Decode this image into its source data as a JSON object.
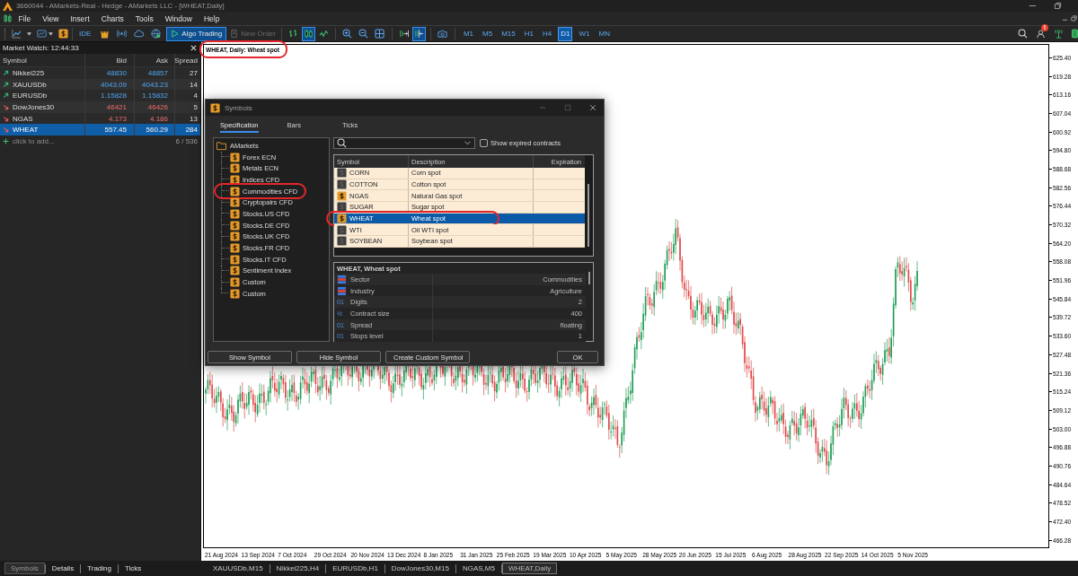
{
  "window": {
    "title": "3660044 - AMarkets-Real - Hedge - AMarkets LLC - [WHEAT,Daily]"
  },
  "menu": [
    "File",
    "View",
    "Insert",
    "Charts",
    "Tools",
    "Window",
    "Help"
  ],
  "toolbar": {
    "ide": "IDE",
    "algo_trading": {
      "label": "Algo Trading",
      "selected": true
    },
    "new_order": {
      "label": "New Order",
      "disabled": true
    },
    "chart_types": [
      {
        "selected": false
      },
      {
        "selected": true
      },
      {
        "selected": false
      }
    ],
    "chart_views": [
      {
        "selected": false
      },
      {
        "selected": true
      }
    ],
    "timeframes": [
      {
        "label": "M1",
        "selected": false
      },
      {
        "label": "M5",
        "selected": false
      },
      {
        "label": "M15",
        "selected": false
      },
      {
        "label": "H1",
        "selected": false
      },
      {
        "label": "H4",
        "selected": false
      },
      {
        "label": "D1",
        "selected": true
      },
      {
        "label": "W1",
        "selected": false
      },
      {
        "label": "MN",
        "selected": false
      }
    ],
    "alert_badge": "!"
  },
  "market_watch": {
    "title": "Market Watch: 12:44:33",
    "columns": [
      "Symbol",
      "Bid",
      "Ask",
      "Spread"
    ],
    "rows": [
      {
        "symbol": "Nikkei225",
        "bid": "48830",
        "ask": "48857",
        "spread": "27",
        "rising": true,
        "selected": false
      },
      {
        "symbol": "XAUUSDb",
        "bid": "4043.09",
        "ask": "4043.23",
        "spread": "14",
        "rising": true,
        "selected": false
      },
      {
        "symbol": "EURUSDb",
        "bid": "1.15828",
        "ask": "1.15832",
        "spread": "4",
        "rising": true,
        "selected": false
      },
      {
        "symbol": "DowJones30",
        "bid": "46421",
        "ask": "46426",
        "spread": "5",
        "rising": false,
        "selected": false
      },
      {
        "symbol": "NGAS",
        "bid": "4.173",
        "ask": "4.186",
        "spread": "13",
        "rising": false,
        "selected": false
      },
      {
        "symbol": "WHEAT",
        "bid": "557.45",
        "ask": "560.29",
        "spread": "284",
        "rising": false,
        "selected": true
      }
    ],
    "add_row": "click to add...",
    "count": "6 / 536"
  },
  "chart": {
    "title": "WHEAT, Daily: Wheat spot",
    "highlighted": true,
    "price_labels": [
      "625.40",
      "619.28",
      "613.16",
      "607.04",
      "600.92",
      "594.80",
      "588.68",
      "582.56",
      "576.44",
      "570.32",
      "564.20",
      "558.08",
      "551.96",
      "545.84",
      "539.72",
      "533.60",
      "527.48",
      "521.36",
      "515.24",
      "509.12",
      "503.00",
      "496.88",
      "490.76",
      "484.64",
      "478.52",
      "472.40",
      "466.28"
    ],
    "date_labels": [
      "21 Aug 2024",
      "13 Sep 2024",
      "7 Oct 2024",
      "29 Oct 2024",
      "20 Nov 2024",
      "13 Dec 2024",
      "8 Jan 2025",
      "31 Jan 2025",
      "25 Feb 2025",
      "19 Mar 2025",
      "10 Apr 2025",
      "5 May 2025",
      "28 May 2025",
      "20 Jun 2025",
      "15 Jul 2025",
      "6 Aug 2025",
      "28 Aug 2025",
      "22 Sep 2025",
      "14 Oct 2025",
      "5 Nov 2025"
    ]
  },
  "symbols_dialog": {
    "title": "Symbols",
    "tabs": [
      {
        "label": "Specification",
        "selected": true
      },
      {
        "label": "Bars",
        "selected": false
      },
      {
        "label": "Ticks",
        "selected": false
      }
    ],
    "tree": [
      {
        "label": "AMarkets",
        "highlighted": false,
        "children": [
          {
            "label": "Forex ECN",
            "highlighted": false
          },
          {
            "label": "Metals ECN",
            "highlighted": false
          },
          {
            "label": "Indices CFD",
            "highlighted": false
          },
          {
            "label": "Commodities CFD",
            "highlighted": true
          },
          {
            "label": "Cryptopairs CFD",
            "highlighted": false
          },
          {
            "label": "Stocks.US CFD",
            "highlighted": false
          },
          {
            "label": "Stocks.DE CFD",
            "highlighted": false
          },
          {
            "label": "Stocks.UK CFD",
            "highlighted": false
          },
          {
            "label": "Stocks.FR CFD",
            "highlighted": false
          },
          {
            "label": "Stocks.IT CFD",
            "highlighted": false
          },
          {
            "label": "Sentiment Index",
            "highlighted": false
          },
          {
            "label": "Custom",
            "highlighted": false
          },
          {
            "label": "Custom",
            "highlighted": false
          }
        ]
      }
    ],
    "show_expired": {
      "label": "Show expired contracts",
      "checked": false
    },
    "symbols_table": {
      "columns": [
        "Symbol",
        "Description",
        "Expiration"
      ],
      "rows": [
        {
          "symbol": "CORN",
          "description": "Corn spot",
          "shown": false,
          "selected": false,
          "highlighted": false
        },
        {
          "symbol": "COTTON",
          "description": "Cotton spot",
          "shown": false,
          "selected": false,
          "highlighted": false
        },
        {
          "symbol": "NGAS",
          "description": "Natural Gas spot",
          "shown": true,
          "selected": false,
          "highlighted": false
        },
        {
          "symbol": "SUGAR",
          "description": "Sugar spot",
          "shown": false,
          "selected": false,
          "highlighted": false
        },
        {
          "symbol": "WHEAT",
          "description": "Wheat spot",
          "shown": true,
          "selected": true,
          "highlighted": true
        },
        {
          "symbol": "WTI",
          "description": "Oil WTI spot",
          "shown": false,
          "selected": false,
          "highlighted": false
        },
        {
          "symbol": "SOYBEAN",
          "description": "Soybean spot",
          "shown": false,
          "selected": false,
          "highlighted": false
        }
      ]
    },
    "details": {
      "title": "WHEAT, Wheat spot",
      "rows": [
        {
          "kind": "category",
          "label": "Sector",
          "value": "Commodities"
        },
        {
          "kind": "category",
          "label": "Industry",
          "value": "Agriculture"
        },
        {
          "kind": "number",
          "icon": "01",
          "label": "Digits",
          "value": "2"
        },
        {
          "kind": "number",
          "icon": "½",
          "label": "Contract size",
          "value": "400"
        },
        {
          "kind": "number",
          "icon": "01",
          "label": "Spread",
          "value": "floating"
        },
        {
          "kind": "number",
          "icon": "01",
          "label": "Stops level",
          "value": "1"
        }
      ]
    },
    "buttons": [
      {
        "label": "Show Symbol",
        "kind": "action"
      },
      {
        "label": "Hide Symbol",
        "kind": "action"
      },
      {
        "label": "Create Custom Symbol",
        "kind": "action"
      },
      {
        "label": "OK",
        "kind": "confirm"
      }
    ]
  },
  "bottom_tabs": [
    {
      "label": "Symbols",
      "selected": true
    },
    {
      "label": "Details",
      "selected": false
    },
    {
      "label": "Trading",
      "selected": false
    },
    {
      "label": "Ticks",
      "selected": false
    }
  ],
  "chart_tabs": [
    {
      "label": "XAUUSDb,M15",
      "selected": false
    },
    {
      "label": "Nikkei225,H4",
      "selected": false
    },
    {
      "label": "EURUSDb,H1",
      "selected": false
    },
    {
      "label": "DowJones30,M15",
      "selected": false
    },
    {
      "label": "NGAS,M5",
      "selected": false
    },
    {
      "label": "WHEAT,Daily",
      "selected": true
    }
  ]
}
